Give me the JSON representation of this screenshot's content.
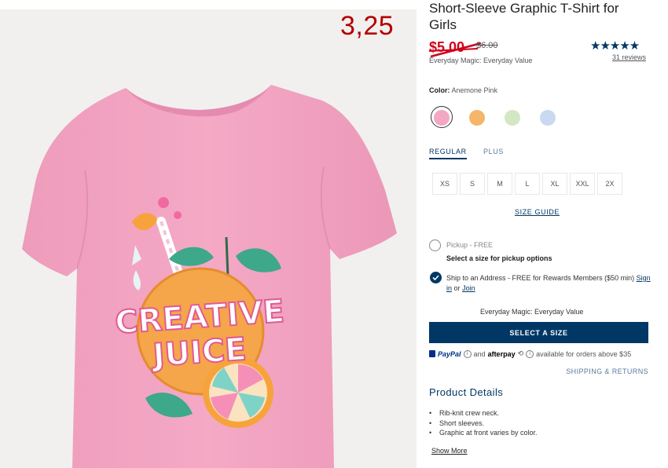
{
  "annotation": "3,25",
  "product": {
    "title": "Short-Sleeve Graphic T-Shirt for Girls",
    "sale_price": "$5.00",
    "original_price": "$6.00",
    "price_note": "Everyday Magic: Everyday Value",
    "rating_stars": "★★★★★",
    "reviews_link": "31 reviews",
    "graphic_words": [
      "CREATIVE",
      "JUICE"
    ]
  },
  "color": {
    "label": "Color:",
    "selected": "Anemone Pink",
    "swatches": [
      {
        "name": "Anemone Pink",
        "hex": "#f4a7c2",
        "selected": true
      },
      {
        "name": "Orange",
        "hex": "#f5b56a",
        "selected": false
      },
      {
        "name": "Green",
        "hex": "#d3e8c2",
        "selected": false
      },
      {
        "name": "Blue",
        "hex": "#c9d9ef",
        "selected": false
      }
    ]
  },
  "fit_tabs": [
    "REGULAR",
    "PLUS"
  ],
  "sizes": [
    "XS",
    "S",
    "M",
    "L",
    "XL",
    "XXL",
    "2X"
  ],
  "size_guide": "SIZE GUIDE",
  "fulfillment": {
    "pickup_label": "Pickup - FREE",
    "pickup_note": "Select a size for pickup options",
    "ship_label": "Ship to an Address - FREE for Rewards Members ($50 min)",
    "sign_in": "Sign in",
    "or_text": "or",
    "join": "Join"
  },
  "value_note": "Everyday Magic: Everyday Value",
  "cta": "SELECT A SIZE",
  "payment": {
    "paypal": "PayPal",
    "and_text": "and",
    "afterpay": "afterpay",
    "afterpay_glyph": "⟲",
    "info_glyph": "i",
    "availability": "available for orders above $35"
  },
  "shipping_returns": "SHIPPING & RETURNS",
  "details": {
    "heading": "Product Details",
    "bullets": [
      "Rib-knit crew neck.",
      "Short sleeves.",
      "Graphic at front varies by color."
    ],
    "show_more": "Show More"
  },
  "colors": {
    "navy": "#003764",
    "sale_red": "#d0021b",
    "shirt_pink": "#f2a3c0",
    "annotation_red": "#b40000"
  }
}
